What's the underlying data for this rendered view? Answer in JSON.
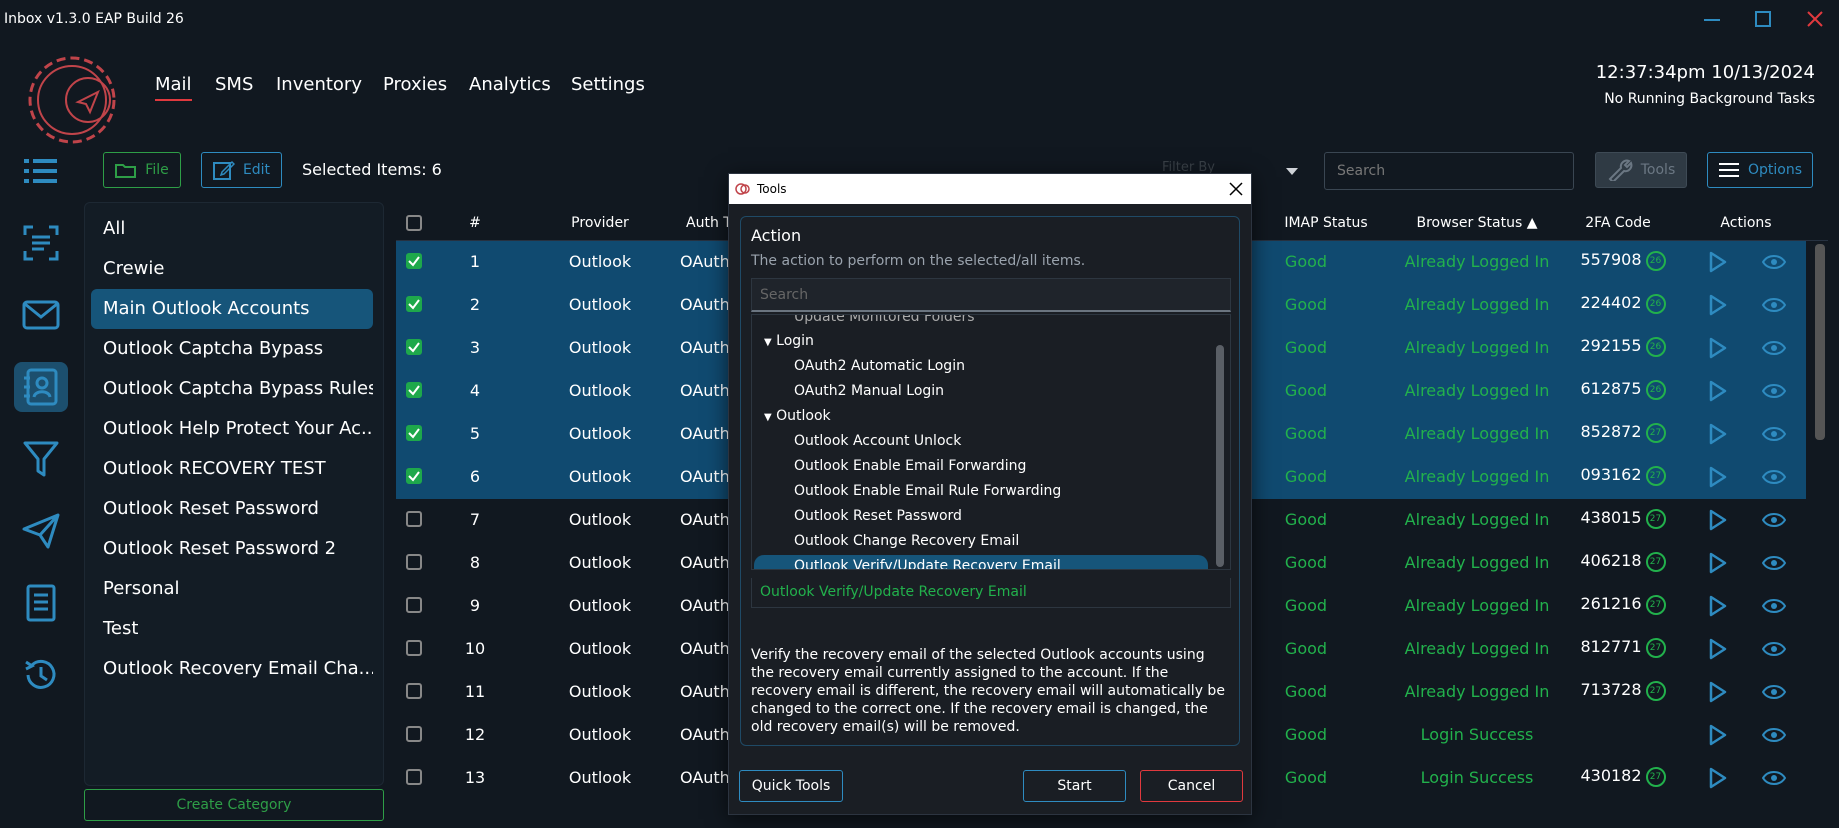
{
  "window": {
    "title": "Inbox v1.3.0 EAP Build 26"
  },
  "nav": {
    "items": [
      "Mail",
      "SMS",
      "Inventory",
      "Proxies",
      "Analytics",
      "Settings"
    ],
    "active": "Mail"
  },
  "status": {
    "clock": "12:37:34pm 10/13/2024",
    "tasks": "No Running Background Tasks"
  },
  "toolbar": {
    "file": "File",
    "edit": "Edit",
    "selected": "Selected Items: 6",
    "filter_placeholder": "Filter By",
    "search_placeholder": "Search",
    "tools": "Tools",
    "options": "Options"
  },
  "categories": {
    "items": [
      "All",
      "Crewie",
      "Main Outlook Accounts",
      "Outlook Captcha Bypass",
      "Outlook Captcha Bypass Rules",
      "Outlook Help Protect Your Ac...",
      "Outlook RECOVERY TEST",
      "Outlook Reset Password",
      "Outlook Reset Password 2",
      "Personal",
      "Test",
      "Outlook Recovery Email Cha..."
    ],
    "active_index": 2,
    "create": "Create Category"
  },
  "table": {
    "headers": {
      "num": "#",
      "provider": "Provider",
      "auth": "Auth Ty",
      "imap": "IMAP Status",
      "browser": "Browser Status",
      "twofa": "2FA Code",
      "actions": "Actions"
    },
    "rows": [
      {
        "n": "1",
        "provider": "Outlook",
        "auth": "OAuth",
        "imap": "Good",
        "browser": "Already Logged In",
        "code": "557908",
        "t": "26",
        "checked": true
      },
      {
        "n": "2",
        "provider": "Outlook",
        "auth": "OAuth",
        "imap": "Good",
        "browser": "Already Logged In",
        "code": "224402",
        "t": "26",
        "checked": true
      },
      {
        "n": "3",
        "provider": "Outlook",
        "auth": "OAuth",
        "imap": "Good",
        "browser": "Already Logged In",
        "code": "292155",
        "t": "26",
        "checked": true
      },
      {
        "n": "4",
        "provider": "Outlook",
        "auth": "OAuth",
        "imap": "Good",
        "browser": "Already Logged In",
        "code": "612875",
        "t": "26",
        "checked": true
      },
      {
        "n": "5",
        "provider": "Outlook",
        "auth": "OAuth",
        "imap": "Good",
        "browser": "Already Logged In",
        "code": "852872",
        "t": "27",
        "checked": true
      },
      {
        "n": "6",
        "provider": "Outlook",
        "auth": "OAuth",
        "imap": "Good",
        "browser": "Already Logged In",
        "code": "093162",
        "t": "27",
        "checked": true
      },
      {
        "n": "7",
        "provider": "Outlook",
        "auth": "OAuth",
        "imap": "Good",
        "browser": "Already Logged In",
        "code": "438015",
        "t": "27",
        "checked": false
      },
      {
        "n": "8",
        "provider": "Outlook",
        "auth": "OAuth",
        "imap": "Good",
        "browser": "Already Logged In",
        "code": "406218",
        "t": "27",
        "checked": false
      },
      {
        "n": "9",
        "provider": "Outlook",
        "auth": "OAuth",
        "imap": "Good",
        "browser": "Already Logged In",
        "code": "261216",
        "t": "27",
        "checked": false
      },
      {
        "n": "10",
        "provider": "Outlook",
        "auth": "OAuth",
        "imap": "Good",
        "browser": "Already Logged In",
        "code": "812771",
        "t": "27",
        "checked": false
      },
      {
        "n": "11",
        "provider": "Outlook",
        "auth": "OAuth",
        "imap": "Good",
        "browser": "Already Logged In",
        "code": "713728",
        "t": "27",
        "checked": false
      },
      {
        "n": "12",
        "provider": "Outlook",
        "auth": "OAuth",
        "imap": "Good",
        "browser": "Login Success",
        "code": "",
        "t": "",
        "checked": false
      },
      {
        "n": "13",
        "provider": "Outlook",
        "auth": "OAuth",
        "imap": "Good",
        "browser": "Login Success",
        "code": "430182",
        "t": "27",
        "checked": false
      }
    ]
  },
  "modal": {
    "title": "Tools",
    "action_label": "Action",
    "action_desc": "The action to perform on the selected/all items.",
    "search_placeholder": "Search",
    "tree": {
      "partial": "Update Monitored Folders",
      "group1": "Login",
      "login_items": [
        "OAuth2 Automatic Login",
        "OAuth2 Manual Login"
      ],
      "group2": "Outlook",
      "outlook_items": [
        "Outlook Account Unlock",
        "Outlook Enable Email Forwarding",
        "Outlook Enable Email Rule Forwarding",
        "Outlook Reset Password",
        "Outlook Change Recovery Email",
        "Outlook Verify/Update Recovery Email"
      ]
    },
    "selected_value": "Outlook Verify/Update Recovery Email",
    "description": "Verify the recovery email of the selected Outlook accounts using the recovery email currently assigned to the account. If the recovery email is different, the recovery email will automatically be changed to the correct one. If the recovery email is changed, the old recovery email(s) will be removed.",
    "quick_tools": "Quick Tools",
    "start": "Start",
    "cancel": "Cancel"
  }
}
